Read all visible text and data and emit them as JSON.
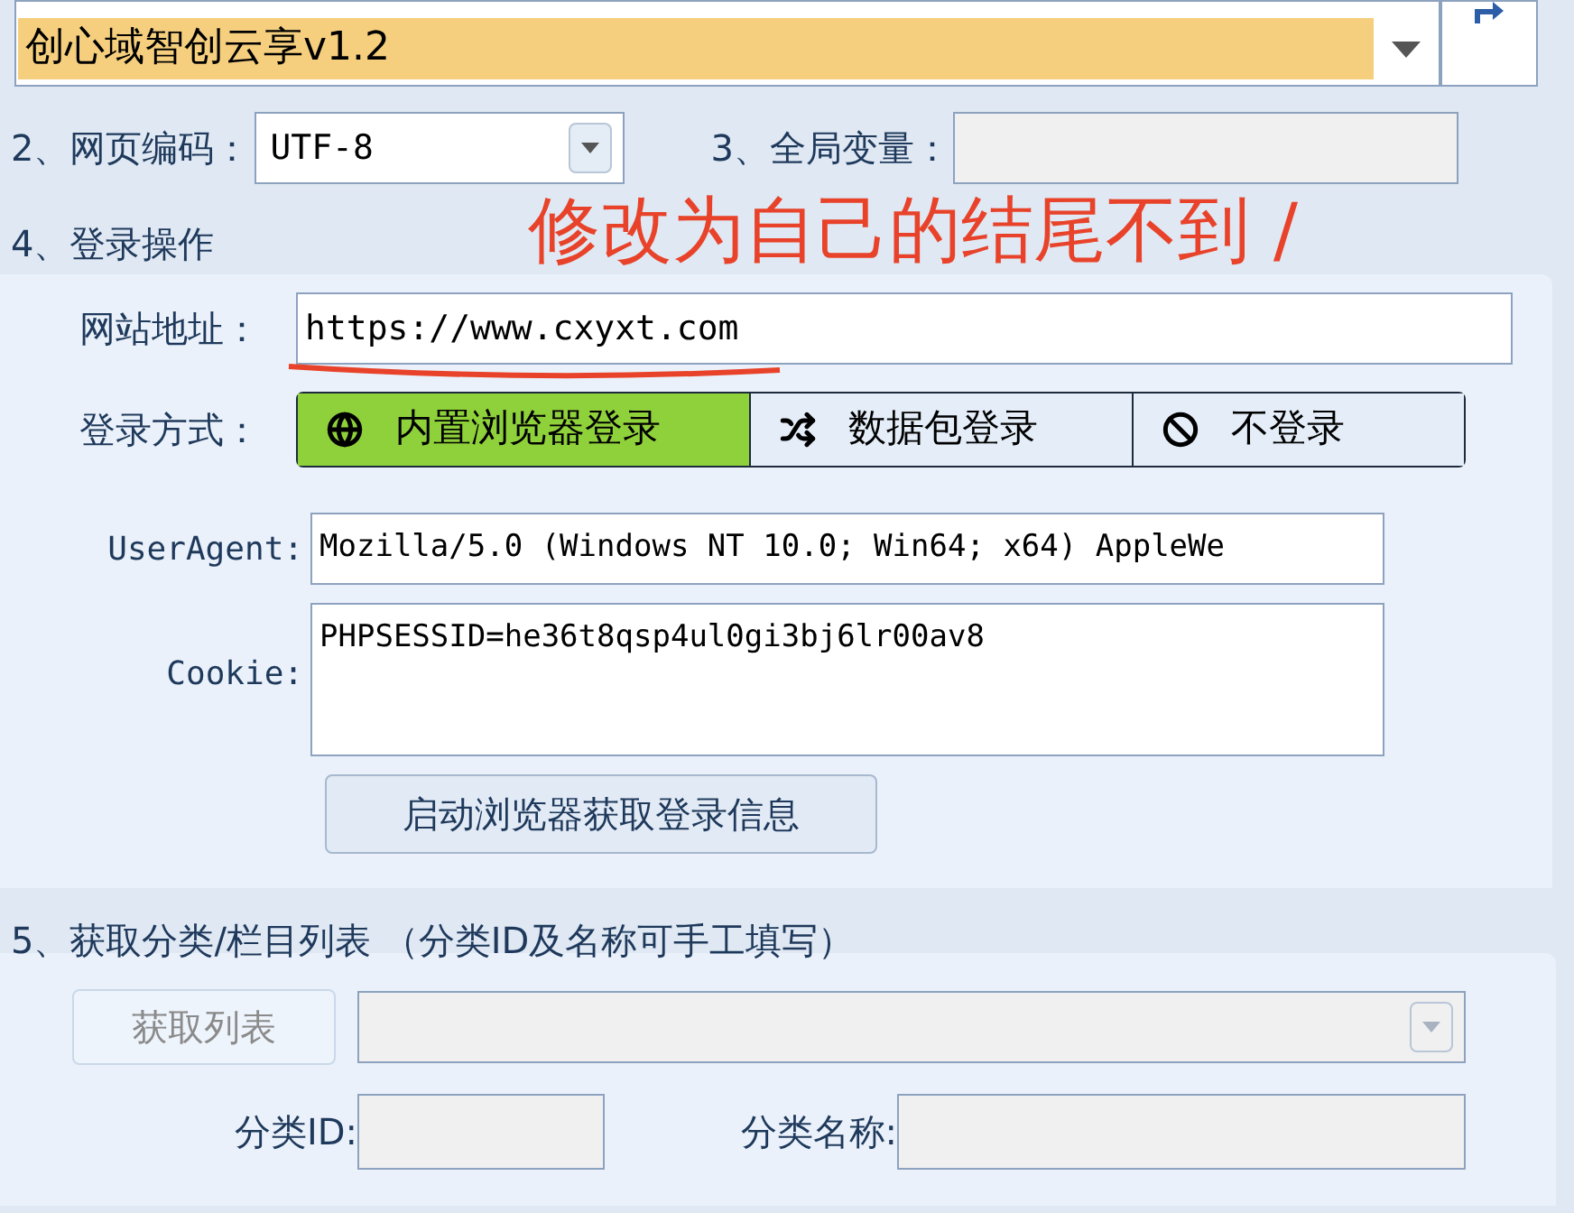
{
  "template_select": {
    "value": "创心域智创云享v1.2"
  },
  "encoding": {
    "label": "2、网页编码：",
    "value": "UTF-8"
  },
  "global_var": {
    "label": "3、全局变量：",
    "disabled": true
  },
  "login_section": {
    "title": "4、登录操作"
  },
  "annotation": {
    "text": "修改为自己的结尾不到 /"
  },
  "site_url": {
    "label": "网站地址：",
    "value": "https://www.cxyxt.com"
  },
  "login_method": {
    "label": "登录方式：",
    "options": [
      {
        "label": "内置浏览器登录",
        "kind": "globe",
        "selected": true
      },
      {
        "label": "数据包登录",
        "kind": "shuffle",
        "selected": false
      },
      {
        "label": "不登录",
        "kind": "ban",
        "selected": false
      }
    ]
  },
  "user_agent": {
    "label": "UserAgent:",
    "value": "Mozilla/5.0 (Windows NT 10.0; Win64; x64) AppleWe"
  },
  "cookie": {
    "label": "Cookie:",
    "value": "PHPSESSID=he36t8qsp4ul0gi3bj6lr00av8"
  },
  "launch_button": {
    "label": "启动浏览器获取登录信息"
  },
  "category_section": {
    "title": "5、获取分类/栏目列表 （分类ID及名称可手工填写）"
  },
  "fetch_button": {
    "label": "获取列表",
    "disabled": true
  },
  "category_select": {
    "disabled": true
  },
  "category_id": {
    "label": "分类ID:",
    "disabled": true
  },
  "category_name": {
    "label": "分类名称:",
    "disabled": true
  }
}
